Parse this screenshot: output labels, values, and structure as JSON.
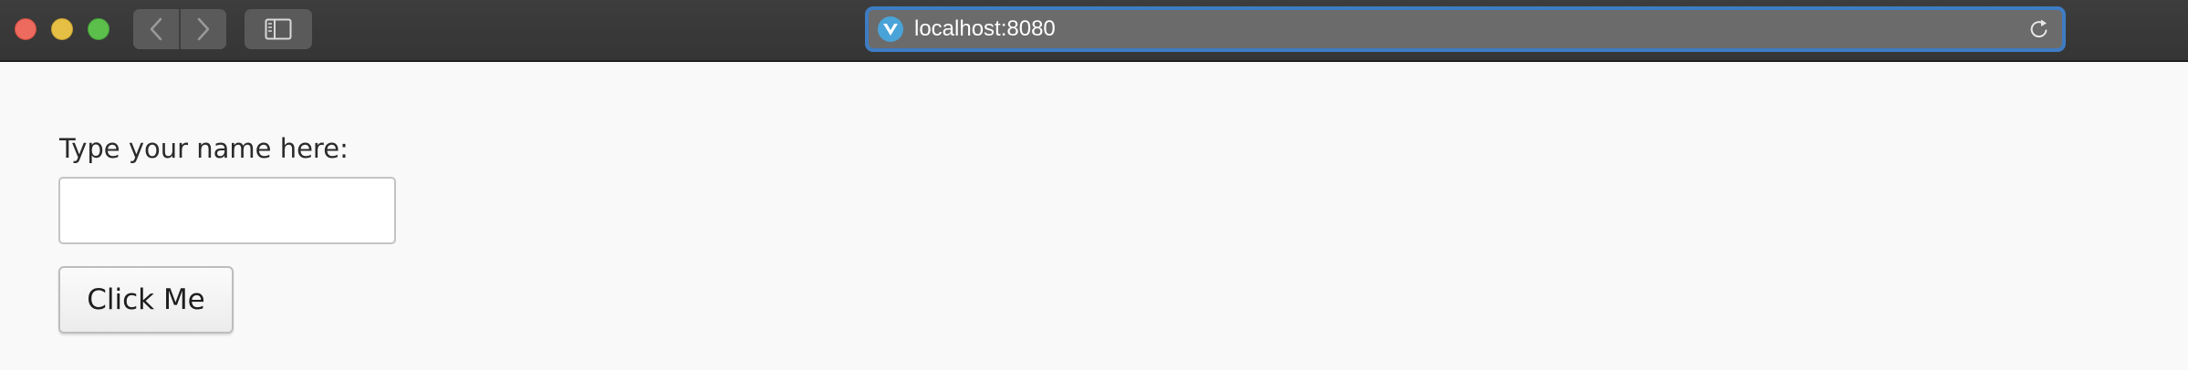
{
  "browser": {
    "address_bar": {
      "url": "localhost:8080"
    },
    "icons": {
      "back": "chevron-left-icon",
      "forward": "chevron-right-icon",
      "sidebar": "sidebar-icon",
      "site": "vue-logo-icon",
      "reload": "reload-icon"
    },
    "colors": {
      "toolbar": "#393939",
      "address_focus": "#3d7cc3",
      "close": "#ed6a5e",
      "minimize": "#e6bf45",
      "zoom": "#5cbf4c"
    }
  },
  "page": {
    "name_label": "Type your name here:",
    "name_input": {
      "value": "",
      "placeholder": ""
    },
    "button_label": "Click Me"
  }
}
